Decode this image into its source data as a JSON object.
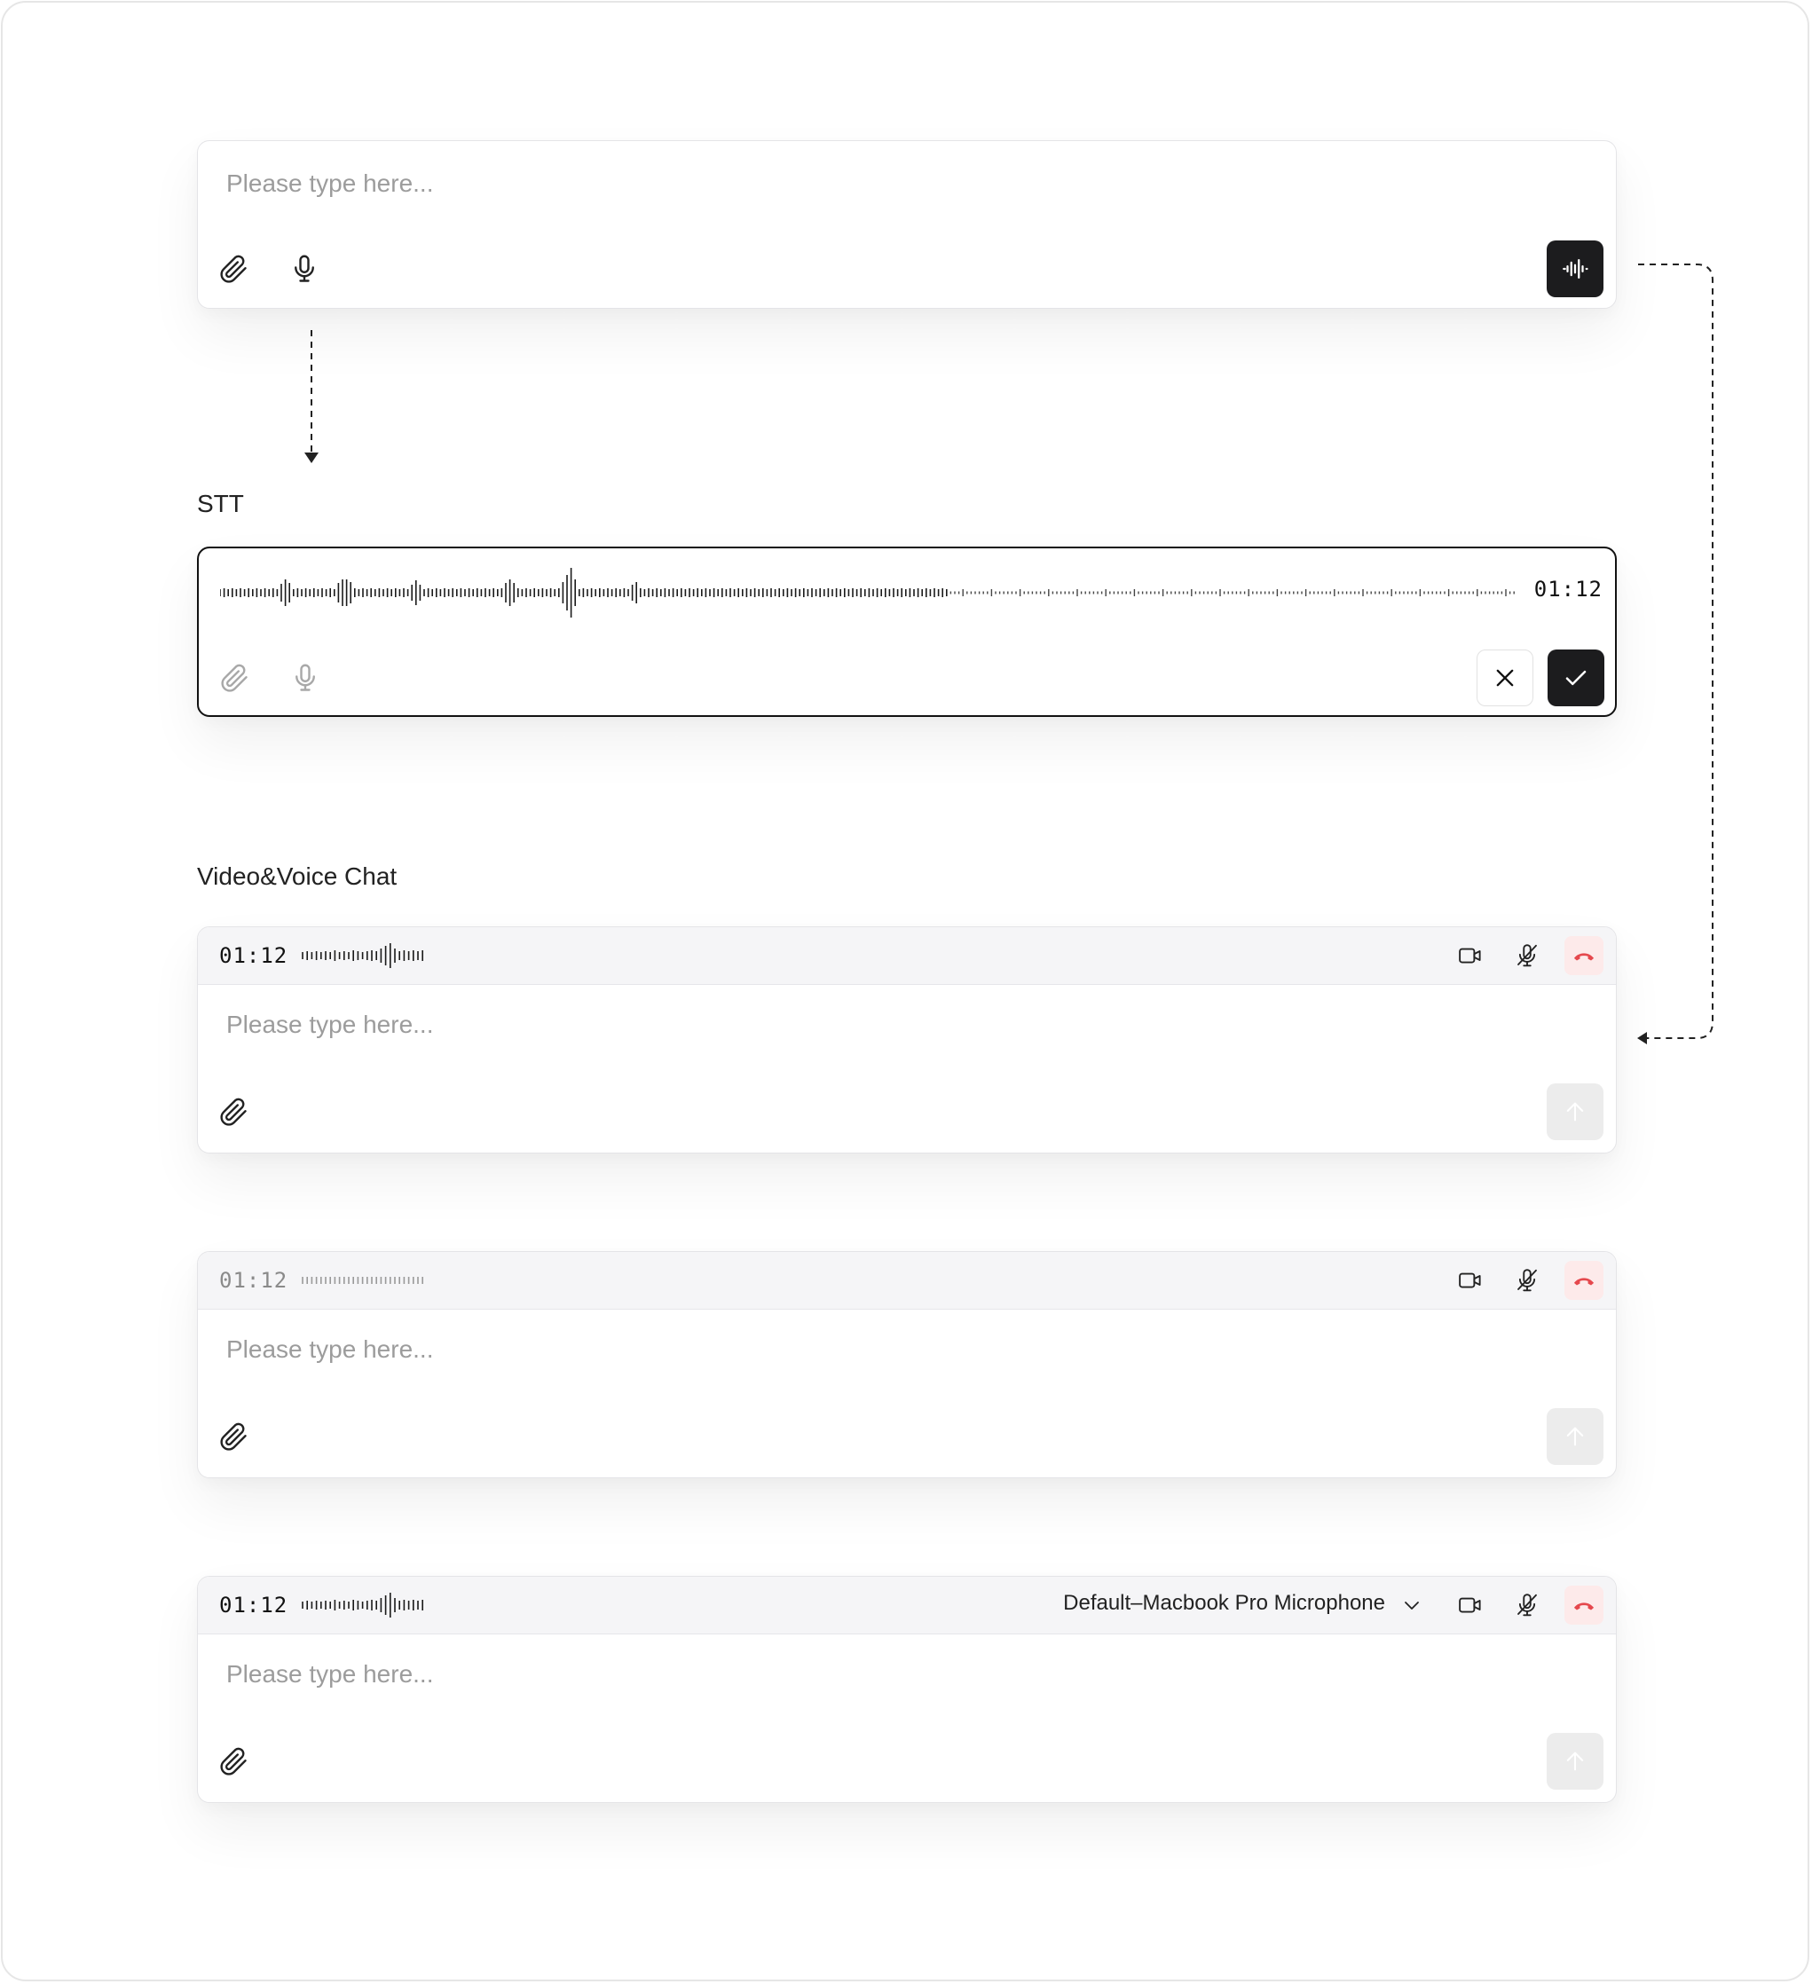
{
  "composer": {
    "placeholder": "Please type here...",
    "attach_icon": "paperclip-icon",
    "mic_icon": "microphone-icon",
    "voice_chat_icon": "waveform-icon"
  },
  "stt": {
    "label": "STT",
    "timer": "01:12",
    "cancel_icon": "close-icon",
    "confirm_icon": "check-icon"
  },
  "video_voice": {
    "label": "Video&Voice Chat",
    "panels": [
      {
        "timer": "01:12",
        "state": "active",
        "placeholder": "Please type here..."
      },
      {
        "timer": "01:12",
        "state": "muted",
        "placeholder": "Please type here..."
      },
      {
        "timer": "01:12",
        "state": "active",
        "device": "Default–Macbook Pro Microphone",
        "placeholder": "Please type here..."
      }
    ],
    "icons": [
      "video-camera-icon",
      "microphone-muted-icon",
      "hang-up-icon",
      "send-arrow-icon"
    ],
    "colors": {
      "hangup": "#e5484d",
      "dark_button": "#1c1c1e"
    }
  }
}
